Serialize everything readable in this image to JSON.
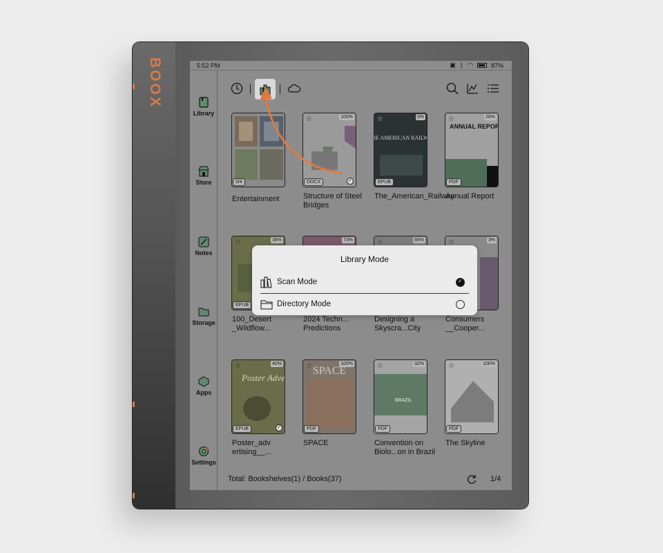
{
  "device": {
    "brand": "BOOX"
  },
  "status": {
    "time": "5:52 PM",
    "battery": "87%"
  },
  "sidebar": {
    "items": [
      {
        "label": "Library",
        "icon": "book-icon"
      },
      {
        "label": "Store",
        "icon": "store-icon"
      },
      {
        "label": "Notes",
        "icon": "notes-icon"
      },
      {
        "label": "Storage",
        "icon": "folder-icon"
      },
      {
        "label": "Apps",
        "icon": "apps-icon"
      },
      {
        "label": "Settings",
        "icon": "settings-icon"
      }
    ]
  },
  "toolbar": {
    "icons": [
      "recent-icon",
      "library-mode-icon",
      "cloud-icon",
      "search-icon",
      "stats-icon",
      "list-icon"
    ]
  },
  "books": [
    {
      "title": "Entertainment",
      "badge": "0/4",
      "format": "",
      "progress": ""
    },
    {
      "title": "Structure of Steel Bridges",
      "badge": "",
      "format": "DOCX",
      "progress": "100%"
    },
    {
      "title": "The_American_Railway",
      "badge": "",
      "format": "EPUB",
      "progress": "0%"
    },
    {
      "title": "Annual Report",
      "badge": "",
      "format": "PDF",
      "progress": "28%"
    },
    {
      "title": "100_Desert _Wildflow...",
      "badge": "",
      "format": "EPUB",
      "progress": "38%"
    },
    {
      "title": "2024 Techn... Predictions",
      "badge": "",
      "format": "",
      "progress": "73%"
    },
    {
      "title": "Designing a Skyscra...City",
      "badge": "",
      "format": "",
      "progress": "66%"
    },
    {
      "title": "Consumers __Cooper...",
      "badge": "",
      "format": "",
      "progress": "3%"
    },
    {
      "title": "Poster_adv ertising__...",
      "badge": "",
      "format": "EPUB",
      "progress": "40%"
    },
    {
      "title": "SPACE",
      "badge": "",
      "format": "PDF",
      "progress": "100%"
    },
    {
      "title": "Convention on Biolo...on in Brazil",
      "badge": "",
      "format": "PDF",
      "progress": "32%"
    },
    {
      "title": "The Skyline",
      "badge": "",
      "format": "PDF",
      "progress": "100%"
    }
  ],
  "cover_text": {
    "railway": "THE AMERICAN RAILWAY",
    "annual": "ANNUAL REPORT",
    "poster": "Poster Advertising",
    "space": "SPACE",
    "brazil": "BRAZIL"
  },
  "footer": {
    "total": "Total: Bookshelves(1) / Books(37)",
    "page": "1/4"
  },
  "dialog": {
    "title": "Library Mode",
    "options": [
      {
        "label": "Scan Mode",
        "selected": true
      },
      {
        "label": "Directory Mode",
        "selected": false
      }
    ]
  },
  "colors": {
    "accent": "#e07a3f",
    "brand": "#d77a4a",
    "screen": "#8c8c8c"
  }
}
